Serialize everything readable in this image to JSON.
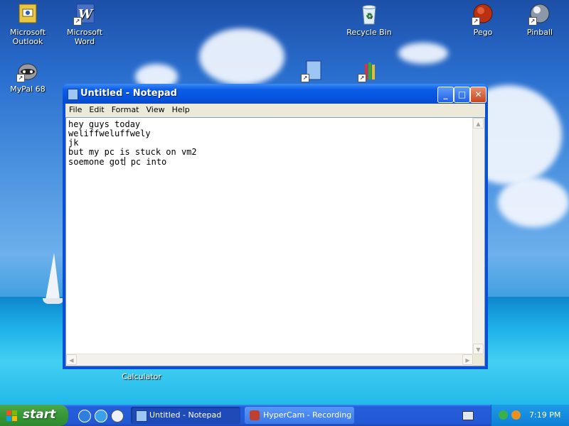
{
  "desktop": {
    "icons": [
      {
        "label": "Microsoft Outlook",
        "icon": "outlook-icon"
      },
      {
        "label": "Microsoft Word",
        "icon": "word-icon"
      },
      {
        "label": "Recycle Bin",
        "icon": "recycle-bin-icon"
      },
      {
        "label": "Pego",
        "icon": "pego-icon"
      },
      {
        "label": "Pinball",
        "icon": "pinball-icon"
      },
      {
        "label": "MyPal 68",
        "icon": "mypal-icon"
      },
      {
        "label": "Calculator",
        "icon": "calculator-icon"
      }
    ]
  },
  "notepad": {
    "title": "Untitled - Notepad",
    "menu": [
      "File",
      "Edit",
      "Format",
      "View",
      "Help"
    ],
    "text_before_caret": "hey guys today\nweliffweluffwely\njk\nbut my pc is stuck on vm2\nsoemone got",
    "text_after_caret": " pc into"
  },
  "taskbar": {
    "start_label": "start",
    "tasks": [
      {
        "label": "Untitled - Notepad",
        "icon": "notepad-icon"
      },
      {
        "label": "HyperCam - Recording",
        "icon": "hypercam-icon"
      }
    ],
    "clock": "7:19 PM"
  },
  "colors": {
    "title_bar": "#0b5ce8",
    "start_button": "#3a9a3a",
    "taskbar": "#2359d6",
    "tray": "#0f7fd6"
  }
}
